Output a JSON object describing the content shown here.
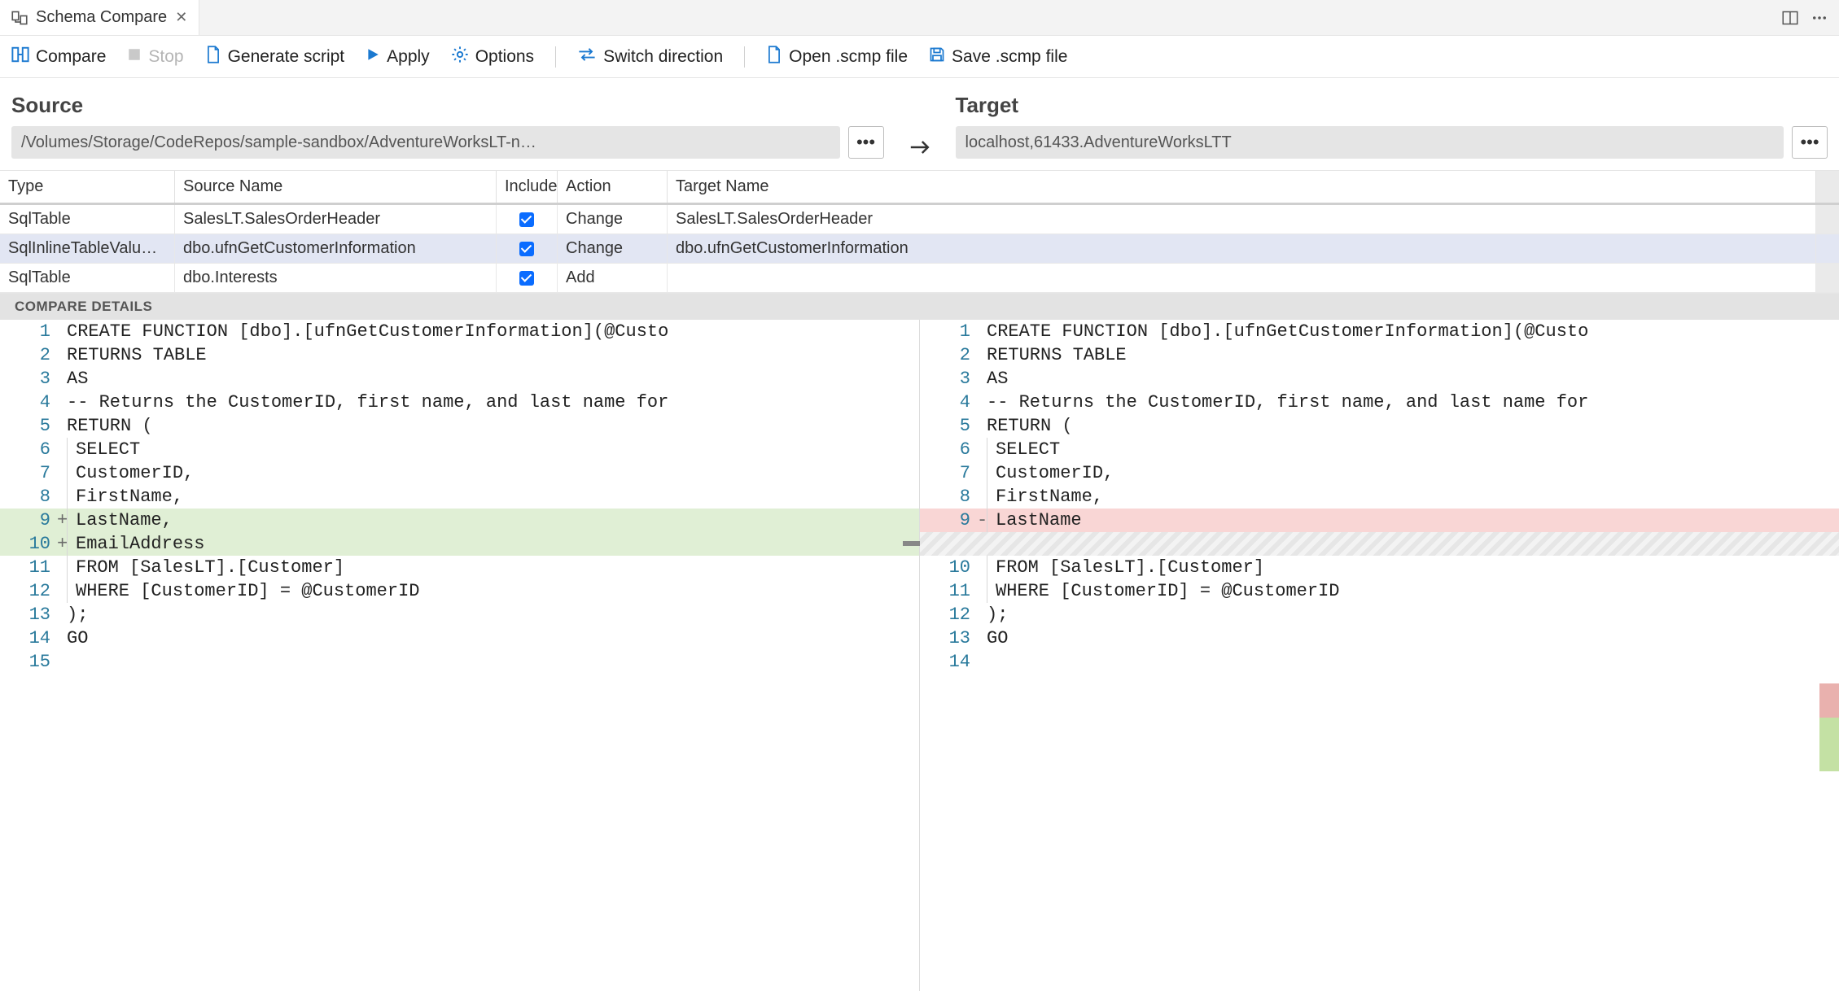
{
  "tab": {
    "title": "Schema Compare"
  },
  "toolbar": {
    "compare": "Compare",
    "stop": "Stop",
    "generate": "Generate script",
    "apply": "Apply",
    "options": "Options",
    "switch": "Switch direction",
    "open": "Open .scmp file",
    "save": "Save .scmp file"
  },
  "labels": {
    "source": "Source",
    "target": "Target",
    "compareDetails": "COMPARE DETAILS"
  },
  "source": {
    "value": "/Volumes/Storage/CodeRepos/sample-sandbox/AdventureWorksLT-n…"
  },
  "target": {
    "value": "localhost,61433.AdventureWorksLTT"
  },
  "ellipsis": "•••",
  "columns": {
    "type": "Type",
    "sourceName": "Source Name",
    "include": "Include",
    "action": "Action",
    "targetName": "Target Name"
  },
  "rows": [
    {
      "type": "SqlTable",
      "sourceName": "SalesLT.SalesOrderHeader",
      "action": "Change",
      "targetName": "SalesLT.SalesOrderHeader",
      "selected": false
    },
    {
      "type": "SqlInlineTableValuedFu…",
      "sourceName": "dbo.ufnGetCustomerInformation",
      "action": "Change",
      "targetName": "dbo.ufnGetCustomerInformation",
      "selected": true
    },
    {
      "type": "SqlTable",
      "sourceName": "dbo.Interests",
      "action": "Add",
      "targetName": "",
      "selected": false
    }
  ],
  "leftCode": [
    {
      "n": 1,
      "mark": "",
      "cls": "",
      "text": "CREATE FUNCTION [dbo].[ufnGetCustomerInformation](@Custo"
    },
    {
      "n": 2,
      "mark": "",
      "cls": "",
      "text": "RETURNS TABLE "
    },
    {
      "n": 3,
      "mark": "",
      "cls": "",
      "text": "AS "
    },
    {
      "n": 4,
      "mark": "",
      "cls": "",
      "text": "-- Returns the CustomerID, first name, and last name for"
    },
    {
      "n": 5,
      "mark": "",
      "cls": "",
      "text": "RETURN ("
    },
    {
      "n": 6,
      "mark": "",
      "cls": "indent",
      "text": "SELECT "
    },
    {
      "n": 7,
      "mark": "",
      "cls": "indent",
      "text": "CustomerID, "
    },
    {
      "n": 8,
      "mark": "",
      "cls": "indent",
      "text": "FirstName, "
    },
    {
      "n": 9,
      "mark": "+",
      "cls": "add indent",
      "text": "LastName,"
    },
    {
      "n": 10,
      "mark": "+",
      "cls": "add indent",
      "text": "EmailAddress"
    },
    {
      "n": 11,
      "mark": "",
      "cls": "indent",
      "text": "FROM [SalesLT].[Customer] "
    },
    {
      "n": 12,
      "mark": "",
      "cls": "indent",
      "text": "WHERE [CustomerID] = @CustomerID"
    },
    {
      "n": 13,
      "mark": "",
      "cls": "",
      "text": ");"
    },
    {
      "n": 14,
      "mark": "",
      "cls": "",
      "text": "GO"
    },
    {
      "n": 15,
      "mark": "",
      "cls": "",
      "text": ""
    }
  ],
  "rightCode": [
    {
      "n": 1,
      "mark": "",
      "cls": "",
      "text": "CREATE FUNCTION [dbo].[ufnGetCustomerInformation](@Custo"
    },
    {
      "n": 2,
      "mark": "",
      "cls": "",
      "text": "RETURNS TABLE "
    },
    {
      "n": 3,
      "mark": "",
      "cls": "",
      "text": "AS "
    },
    {
      "n": 4,
      "mark": "",
      "cls": "",
      "text": "-- Returns the CustomerID, first name, and last name for"
    },
    {
      "n": 5,
      "mark": "",
      "cls": "",
      "text": "RETURN ("
    },
    {
      "n": 6,
      "mark": "",
      "cls": "indent",
      "text": "SELECT "
    },
    {
      "n": 7,
      "mark": "",
      "cls": "indent",
      "text": "CustomerID, "
    },
    {
      "n": 8,
      "mark": "",
      "cls": "indent",
      "text": "FirstName, "
    },
    {
      "n": 9,
      "mark": "-",
      "cls": "del indent",
      "text": "LastName"
    },
    {
      "n": "",
      "mark": "",
      "cls": "hatch",
      "text": ""
    },
    {
      "n": 10,
      "mark": "",
      "cls": "indent",
      "text": "FROM [SalesLT].[Customer] "
    },
    {
      "n": 11,
      "mark": "",
      "cls": "indent",
      "text": "WHERE [CustomerID] = @CustomerID"
    },
    {
      "n": 12,
      "mark": "",
      "cls": "",
      "text": ");"
    },
    {
      "n": 13,
      "mark": "",
      "cls": "",
      "text": "GO"
    },
    {
      "n": 14,
      "mark": "",
      "cls": "",
      "text": ""
    }
  ]
}
